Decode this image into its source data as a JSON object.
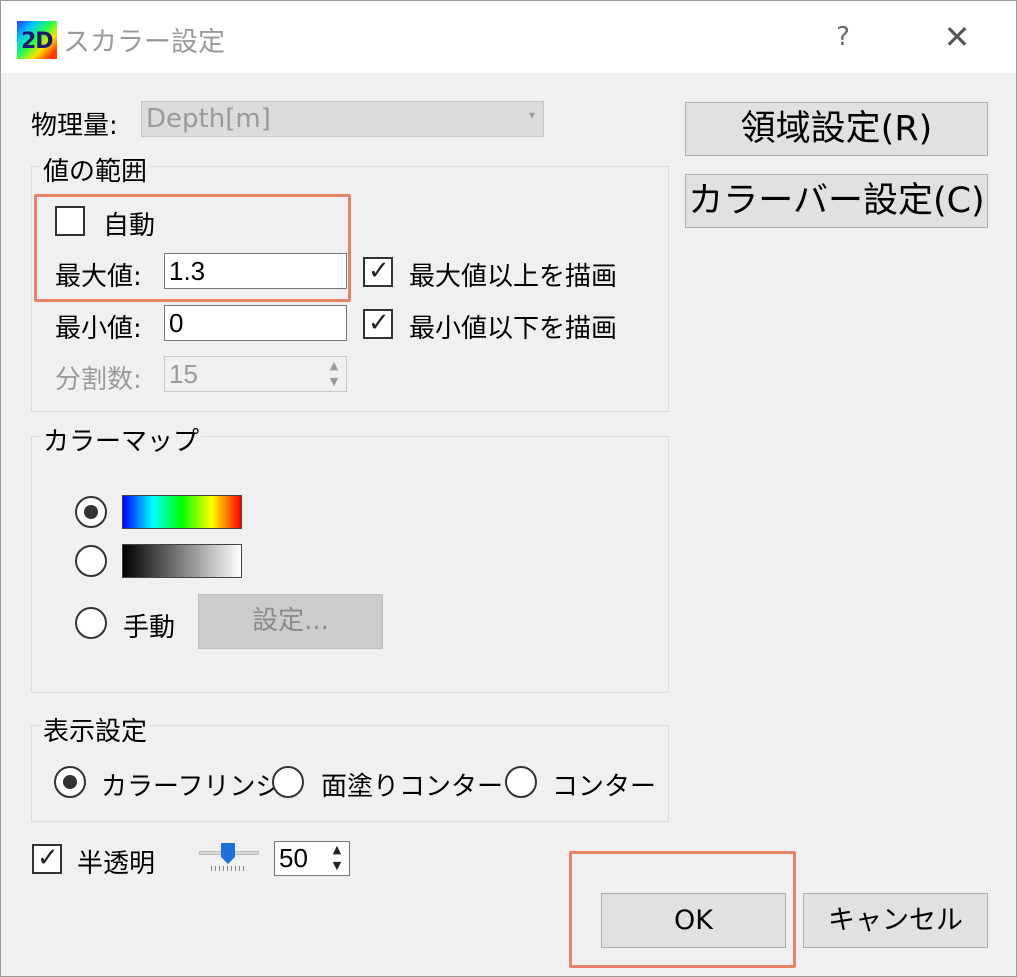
{
  "window": {
    "title": "スカラー設定",
    "help_glyph": "?",
    "close_glyph": "✕",
    "app_icon_text": "2D"
  },
  "physical_quantity": {
    "label": "物理量:",
    "value": "Depth[m]"
  },
  "buttons": {
    "region_settings": "領域設定(R)",
    "colorbar_settings": "カラーバー設定(C)",
    "manual_settings": "設定...",
    "ok": "OK",
    "cancel": "キャンセル"
  },
  "value_range": {
    "title": "値の範囲",
    "auto_label": "自動",
    "auto_checked": false,
    "max_label": "最大値:",
    "max_value": "1.3",
    "min_label": "最小値:",
    "min_value": "0",
    "draw_above_max_label": "最大値以上を描画",
    "draw_above_max_checked": true,
    "draw_below_min_label": "最小値以下を描画",
    "draw_below_min_checked": true,
    "divisions_label": "分割数:",
    "divisions_value": "15"
  },
  "colormap": {
    "title": "カラーマップ",
    "options": [
      {
        "kind": "rainbow",
        "selected": true
      },
      {
        "kind": "grayscale",
        "selected": false
      },
      {
        "label": "手動",
        "selected": false
      }
    ],
    "colors": {
      "rainbow": [
        "#0000ff",
        "#00ffff",
        "#00ff00",
        "#ffff00",
        "#ff0000"
      ],
      "grayscale": [
        "#000000",
        "#ffffff"
      ]
    }
  },
  "display_settings": {
    "title": "表示設定",
    "options": [
      {
        "label": "カラーフリンジ",
        "selected": true
      },
      {
        "label": "面塗りコンター",
        "selected": false
      },
      {
        "label": "コンター",
        "selected": false
      }
    ]
  },
  "transparency": {
    "label": "半透明",
    "checked": true,
    "value": "50"
  },
  "icons": {
    "check": "✓",
    "spin_up": "▲",
    "spin_down": "▼",
    "combo_arrow": "▾"
  },
  "colors": {
    "highlight": "#e8836a",
    "slider_thumb": "#1e6fd9",
    "window_bg": "#f0f0f0"
  }
}
